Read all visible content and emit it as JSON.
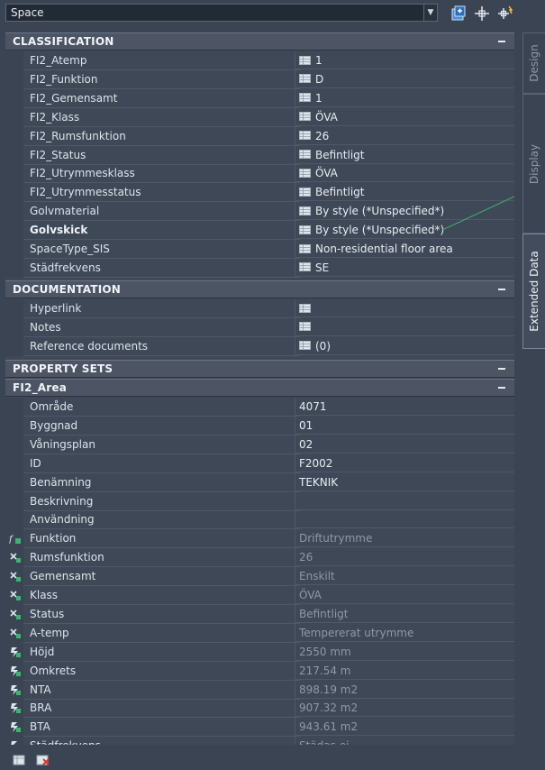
{
  "object_selector": {
    "value": "Space"
  },
  "toolbar": {
    "icons": [
      "quick-select-icon",
      "pick-add-icon",
      "toggle-pickadd-icon"
    ]
  },
  "sections": {
    "classification": {
      "title": "CLASSIFICATION"
    },
    "documentation": {
      "title": "DOCUMENTATION"
    },
    "property_sets": {
      "title": "PROPERTY SETS"
    },
    "fi2_area": {
      "title": "FI2_Area"
    }
  },
  "classification_rows": [
    {
      "name": "FI2_Atemp",
      "value": "1"
    },
    {
      "name": "FI2_Funktion",
      "value": "D"
    },
    {
      "name": "FI2_Gemensamt",
      "value": "1"
    },
    {
      "name": "FI2_Klass",
      "value": "ÖVA"
    },
    {
      "name": "FI2_Rumsfunktion",
      "value": "26"
    },
    {
      "name": "FI2_Status",
      "value": "Befintligt"
    },
    {
      "name": "FI2_Utrymmesklass",
      "value": "ÖVA"
    },
    {
      "name": "FI2_Utrymmesstatus",
      "value": "Befintligt"
    },
    {
      "name": "Golvmaterial",
      "value": "By style (*Unspecified*)"
    },
    {
      "name": "Golvskick",
      "value": "By style (*Unspecified*)"
    },
    {
      "name": "SpaceType_SIS",
      "value": "Non-residential floor area"
    },
    {
      "name": "Städfrekvens",
      "value": "SE"
    }
  ],
  "documentation_rows": [
    {
      "name": "Hyperlink",
      "value": ""
    },
    {
      "name": "Notes",
      "value": ""
    },
    {
      "name": "Reference documents",
      "value": "(0)"
    }
  ],
  "area_rows": [
    {
      "name": "Område",
      "value": "4071"
    },
    {
      "name": "Byggnad",
      "value": "01"
    },
    {
      "name": "Våningsplan",
      "value": "02"
    },
    {
      "name": "ID",
      "value": "F2002"
    },
    {
      "name": "Benämning",
      "value": "TEKNIK"
    },
    {
      "name": "Beskrivning",
      "value": ""
    },
    {
      "name": "Användning",
      "value": ""
    },
    {
      "name": "Funktion",
      "value": "Driftutrymme",
      "icon": "formula-icon"
    },
    {
      "name": "Rumsfunktion",
      "value": "26",
      "icon": "classification-lookup-icon"
    },
    {
      "name": "Gemensamt",
      "value": "Enskilt",
      "icon": "classification-lookup-icon"
    },
    {
      "name": "Klass",
      "value": "ÖVA",
      "icon": "classification-lookup-icon"
    },
    {
      "name": "Status",
      "value": "Befintligt",
      "icon": "classification-lookup-icon"
    },
    {
      "name": "A-temp",
      "value": "Tempererat utrymme",
      "icon": "classification-lookup-icon"
    },
    {
      "name": "Höjd",
      "value": "2550 mm",
      "icon": "automatic-property-icon"
    },
    {
      "name": "Omkrets",
      "value": "217.54 m",
      "icon": "automatic-property-icon"
    },
    {
      "name": "NTA",
      "value": "898.19 m2",
      "icon": "automatic-property-icon"
    },
    {
      "name": "BRA",
      "value": "907.32 m2",
      "icon": "automatic-property-icon"
    },
    {
      "name": "BTA",
      "value": "943.61 m2",
      "icon": "automatic-property-icon"
    },
    {
      "name": "Städfrekvens",
      "value": "Städas ej",
      "icon": "automatic-property-icon"
    }
  ],
  "side_tabs": [
    {
      "label": "Design",
      "active": false
    },
    {
      "label": "Display",
      "active": false
    },
    {
      "label": "Extended Data",
      "active": true
    }
  ],
  "bottom_icons": [
    "add-property-sets-icon",
    "remove-property-sets-icon"
  ],
  "colors": {
    "panel_bg": "#3f4857",
    "section_bg": "#4d5565",
    "text": "#dde3ea",
    "dim_text": "#8e98a6",
    "accent_green": "#3cb371"
  }
}
